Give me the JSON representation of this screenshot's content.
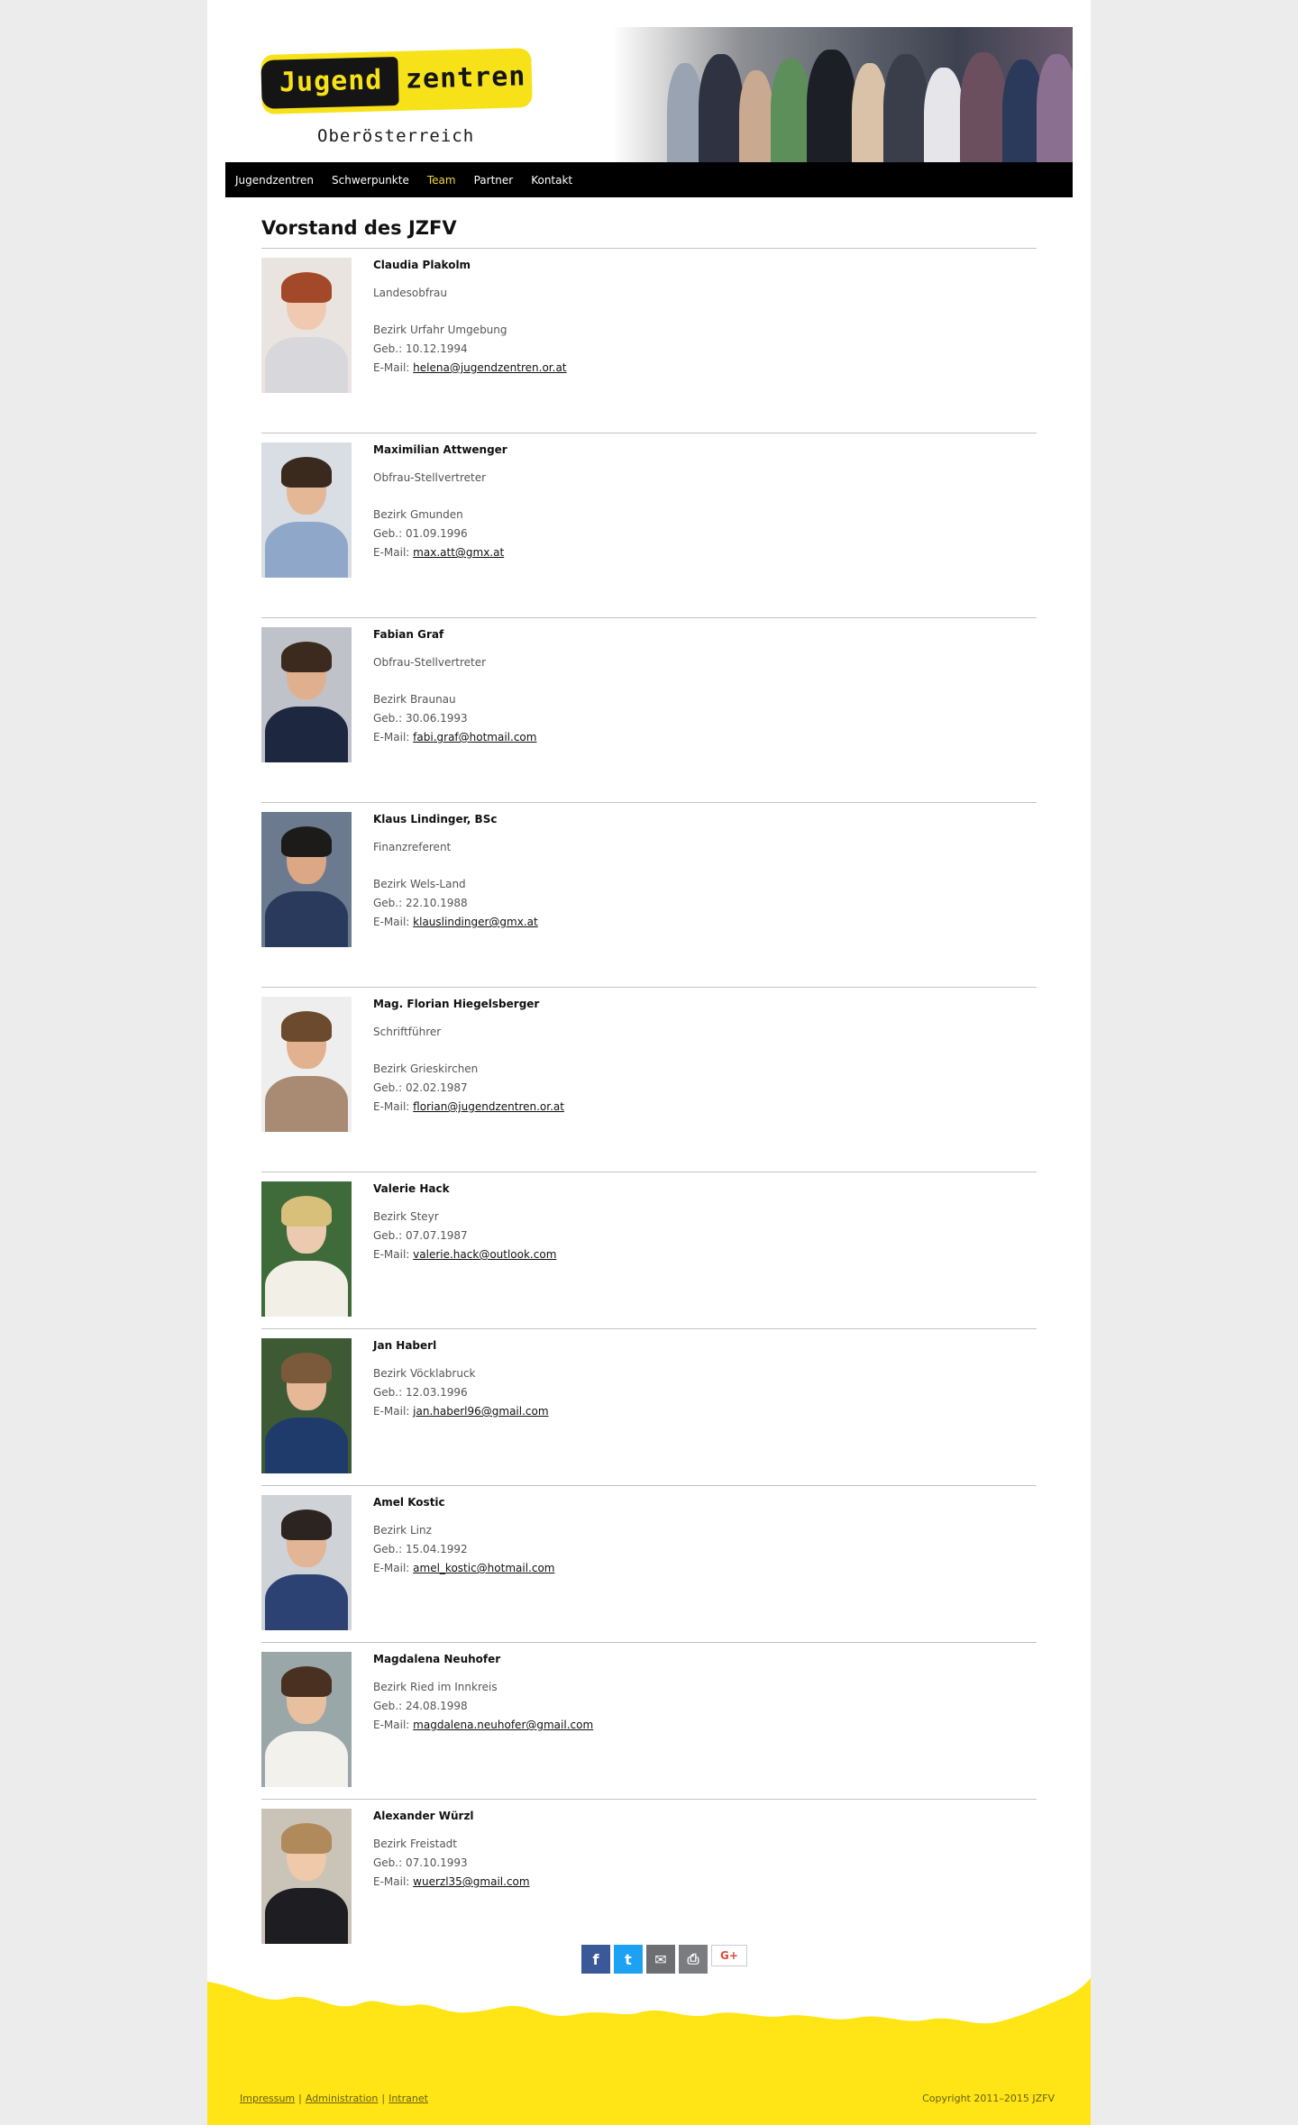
{
  "logo": {
    "part1": "Jugend",
    "part2": "zentren",
    "subtitle": "Oberösterreich"
  },
  "nav": [
    {
      "label": "Jugendzentren",
      "active": false
    },
    {
      "label": "Schwerpunkte",
      "active": false
    },
    {
      "label": "Team",
      "active": true
    },
    {
      "label": "Partner",
      "active": false
    },
    {
      "label": "Kontakt",
      "active": false
    }
  ],
  "heading": "Vorstand des JZFV",
  "email_prefix": "E-Mail:",
  "members": [
    {
      "name": "Claudia Plakolm",
      "role": "Landesobfrau",
      "district": "Bezirk Urfahr Umgebung",
      "birth": "Geb.: 10.12.1994",
      "email": "helena@jugendzentren.or.at"
    },
    {
      "name": "Maximilian Attwenger",
      "role": "Obfrau-Stellvertreter",
      "district": "Bezirk Gmunden",
      "birth": "Geb.: 01.09.1996",
      "email": "max.att@gmx.at"
    },
    {
      "name": "Fabian Graf",
      "role": "Obfrau-Stellvertreter",
      "district": "Bezirk Braunau",
      "birth": "Geb.: 30.06.1993",
      "email": "fabi.graf@hotmail.com"
    },
    {
      "name": "Klaus Lindinger, BSc",
      "role": "Finanzreferent",
      "district": "Bezirk Wels-Land",
      "birth": "Geb.: 22.10.1988",
      "email": "klauslindinger@gmx.at"
    },
    {
      "name": "Mag. Florian Hiegelsberger",
      "role": "Schriftführer",
      "district": "Bezirk Grieskirchen",
      "birth": "Geb.: 02.02.1987",
      "email": "florian@jugendzentren.or.at"
    },
    {
      "name": "Valerie Hack",
      "role": "",
      "district": "Bezirk Steyr",
      "birth": "Geb.: 07.07.1987",
      "email": "valerie.hack@outlook.com"
    },
    {
      "name": "Jan Haberl",
      "role": "",
      "district": "Bezirk Vöcklabruck",
      "birth": "Geb.: 12.03.1996",
      "email": "jan.haberl96@gmail.com"
    },
    {
      "name": "Amel Kostic",
      "role": "",
      "district": "Bezirk Linz",
      "birth": "Geb.: 15.04.1992",
      "email": "amel_kostic@hotmail.com"
    },
    {
      "name": "Magdalena Neuhofer",
      "role": "",
      "district": "Bezirk Ried im Innkreis",
      "birth": "Geb.: 24.08.1998",
      "email": "magdalena.neuhofer@gmail.com"
    },
    {
      "name": "Alexander Würzl",
      "role": "",
      "district": "Bezirk Freistadt",
      "birth": "Geb.: 07.10.1993",
      "email": "wuerzl35@gmail.com"
    }
  ],
  "share": [
    {
      "icon": "facebook-icon",
      "glyph": "f",
      "color": "#3b5998"
    },
    {
      "icon": "twitter-icon",
      "glyph": "t",
      "color": "#1da1f2"
    },
    {
      "icon": "email-icon",
      "glyph": "✉",
      "color": "#6d6e71"
    },
    {
      "icon": "print-icon",
      "glyph": "⎙",
      "color": "#7a7c7f"
    },
    {
      "icon": "google-plus-icon",
      "glyph": "G+",
      "color": "#ffffff"
    }
  ],
  "footer": {
    "links": [
      "Impressum",
      "Administration",
      "Intranet"
    ],
    "copyright": "Copyright 2011–2015 JZFV"
  },
  "colors": {
    "accent": "#f7e21a",
    "nav_active": "#f3d43a",
    "nav_bg": "#000000"
  }
}
